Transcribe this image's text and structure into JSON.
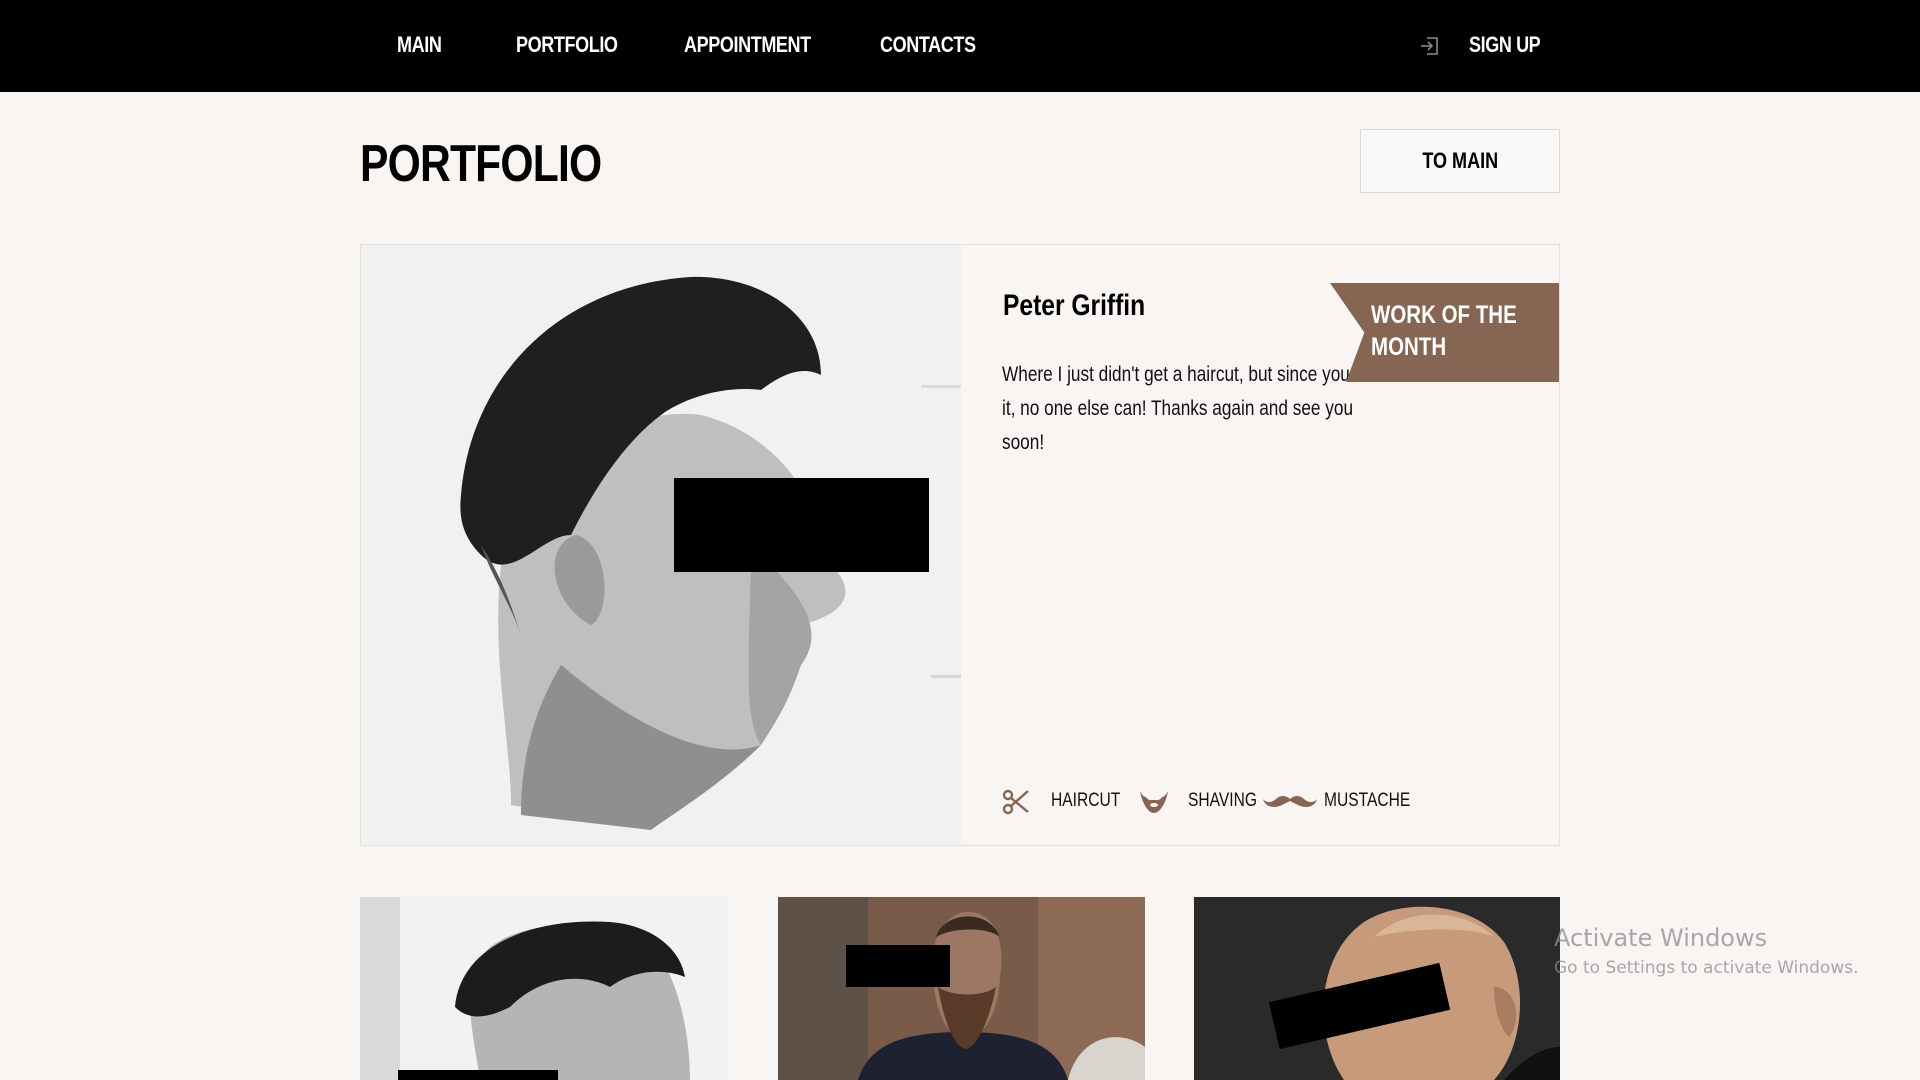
{
  "nav": {
    "items": [
      {
        "label": "MAIN"
      },
      {
        "label": "PORTFOLIO"
      },
      {
        "label": "APPOINTMENT"
      },
      {
        "label": "CONTACTS"
      }
    ],
    "signup_label": "SIGN UP",
    "signup_icon": "sign-in-icon"
  },
  "header": {
    "title": "PORTFOLIO",
    "to_main_label": "TO MAIN"
  },
  "featured": {
    "name": "Peter Griffin",
    "quote": "Where I just didn't get a haircut, but since you do it, no one else can! Thanks again and see you soon!",
    "badge": "WORK OF THE MONTH",
    "badge_color": "#866553",
    "services": [
      {
        "icon": "scissors-icon",
        "label": "HAIRCUT"
      },
      {
        "icon": "beard-icon",
        "label": "SHAVING"
      },
      {
        "icon": "mustache-icon",
        "label": "MUSTACHE"
      }
    ]
  },
  "watermark": {
    "title": "Activate Windows",
    "subtitle": "Go to Settings to activate Windows."
  },
  "colors": {
    "accent": "#866553",
    "background": "#f8f5f2",
    "nav_bg": "#000000"
  }
}
